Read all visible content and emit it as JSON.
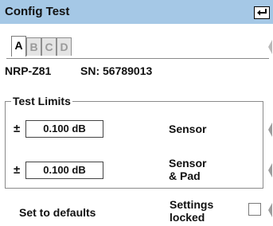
{
  "window": {
    "title": "Config Test",
    "enter_icon": "enter-arrow-icon"
  },
  "tabs": [
    {
      "label": "A",
      "active": true
    },
    {
      "label": "B",
      "active": false
    },
    {
      "label": "C",
      "active": false
    },
    {
      "label": "D",
      "active": false
    }
  ],
  "device": {
    "model": "NRP-Z81",
    "serial": "SN: 56789013"
  },
  "test_limits": {
    "title": "Test Limits",
    "plus_minus": "±",
    "rows": [
      {
        "value": "0.100 dB",
        "label_line1": "Sensor",
        "label_line2": ""
      },
      {
        "value": "0.100 dB",
        "label_line1": "Sensor",
        "label_line2": "& Pad"
      }
    ]
  },
  "footer": {
    "defaults_label": "Set to defaults",
    "settings_line1": "Settings",
    "settings_line2": "locked",
    "settings_locked": false
  },
  "colors": {
    "titlebar": "#a5c8e6",
    "text": "#111111"
  }
}
